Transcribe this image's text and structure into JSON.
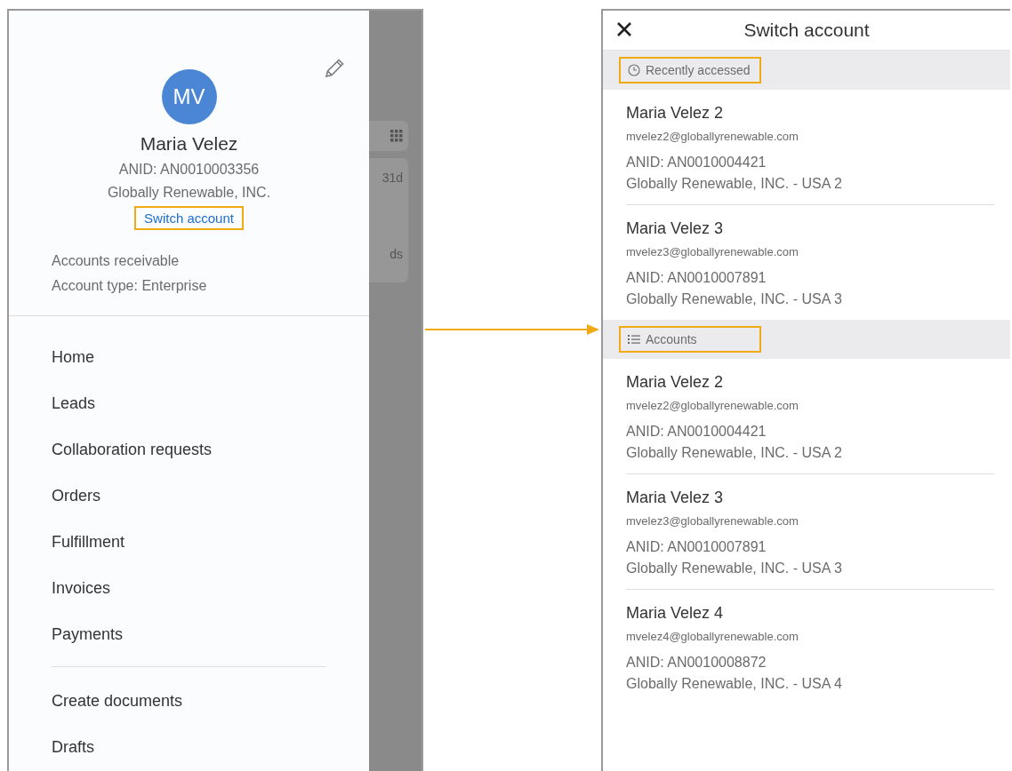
{
  "drawer": {
    "avatar_initials": "MV",
    "name": "Maria Velez",
    "anid": "ANID: AN0010003356",
    "company": "Globally Renewable, INC.",
    "switch_link": {
      "label": "Switch account",
      "highlighted": true
    },
    "role": "Accounts receivable",
    "account_type": "Account type: Enterprise",
    "nav_items": [
      {
        "label": "Home"
      },
      {
        "label": "Leads"
      },
      {
        "label": "Collaboration requests"
      },
      {
        "label": "Orders"
      },
      {
        "label": "Fulfillment"
      },
      {
        "label": "Invoices"
      },
      {
        "label": "Payments"
      }
    ],
    "secondary_items": [
      {
        "label": "Create documents"
      },
      {
        "label": "Drafts"
      }
    ]
  },
  "background_peek": {
    "badge": "31d",
    "text": "ds"
  },
  "switch_screen": {
    "title": "Switch account",
    "sections": [
      {
        "kind": "recent",
        "label": "Recently accessed",
        "highlighted": true,
        "accounts": [
          {
            "name": "Maria Velez 2",
            "email": "mvelez2@globallyrenewable.com",
            "anid": "ANID: AN0010004421",
            "company": "Globally Renewable, INC. - USA 2"
          },
          {
            "name": "Maria Velez 3",
            "email": "mvelez3@globallyrenewable.com",
            "anid": "ANID: AN0010007891",
            "company": "Globally Renewable, INC. - USA 3"
          }
        ]
      },
      {
        "kind": "list",
        "label": "Accounts",
        "highlighted": true,
        "accounts": [
          {
            "name": "Maria Velez 2",
            "email": "mvelez2@globallyrenewable.com",
            "anid": "ANID: AN0010004421",
            "company": "Globally Renewable, INC. - USA 2"
          },
          {
            "name": "Maria Velez 3",
            "email": "mvelez3@globallyrenewable.com",
            "anid": "ANID: AN0010007891",
            "company": "Globally Renewable, INC. - USA 3"
          },
          {
            "name": "Maria Velez 4",
            "email": "mvelez4@globallyrenewable.com",
            "anid": "ANID: AN0010008872",
            "company": "Globally Renewable, INC. - USA 4"
          }
        ]
      }
    ]
  }
}
